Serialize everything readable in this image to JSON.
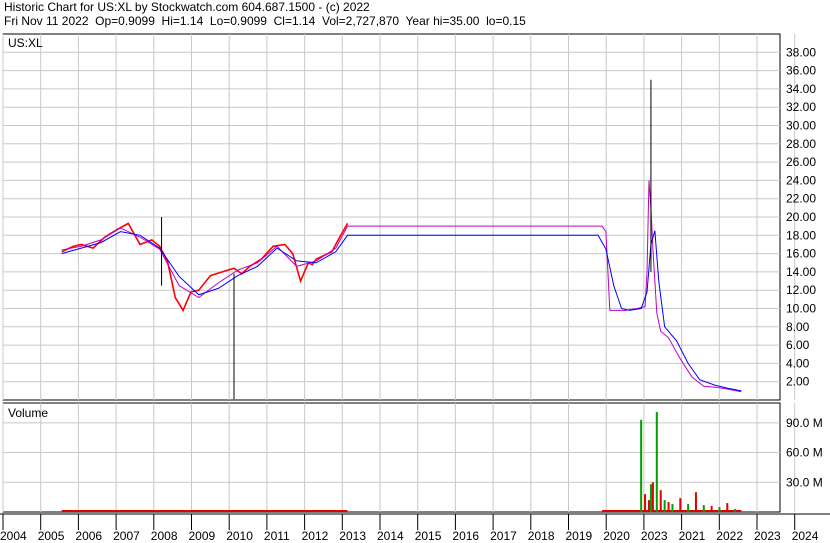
{
  "header": {
    "line1": "Historic Chart for US:XL by Stockwatch.com 604.687.1500 - (c) 2022",
    "line2": "Fri Nov 11 2022  Op=0.9099  Hi=1.14  Lo=0.9099  Cl=1.14  Vol=2,727,870  Year hi=35.00  lo=0.15"
  },
  "colors": {
    "price_up": "#000000",
    "price_down": "#ff0000",
    "ma_short": "#c000c0",
    "ma_long": "#0000ff",
    "vol_up": "#00a000",
    "vol_down": "#e00000",
    "grid": "#c8c8c8"
  },
  "chart_data": [
    {
      "type": "line",
      "panel_label": "US:XL",
      "ylim": [
        0,
        40
      ],
      "yticks": [
        "2.00",
        "4.00",
        "6.00",
        "8.00",
        "10.00",
        "12.00",
        "14.00",
        "16.00",
        "18.00",
        "20.00",
        "22.00",
        "24.00",
        "26.00",
        "28.00",
        "30.00",
        "32.00",
        "34.00",
        "36.00",
        "38.00"
      ],
      "xlim": [
        2004.0,
        2024.0
      ],
      "grid": true,
      "series": [
        {
          "x": [
            2005.5,
            2005.8,
            2006.0,
            2006.3,
            2006.6,
            2006.9,
            2007.2,
            2007.5,
            2007.8,
            2008.0,
            2008.2,
            2008.4,
            2008.6,
            2008.8,
            2009.0,
            2009.3,
            2009.6,
            2009.9,
            2010.1,
            2010.3,
            2010.6,
            2010.9,
            2011.2,
            2011.4,
            2011.6,
            2011.8,
            2011.9,
            2012.0,
            2012.2,
            2012.4,
            2012.6,
            2012.8
          ],
          "values": [
            16.2,
            16.8,
            17.0,
            16.6,
            17.8,
            18.6,
            19.3,
            17.0,
            17.5,
            16.8,
            15.2,
            11.2,
            9.8,
            11.8,
            12.0,
            13.6,
            14.0,
            14.4,
            13.8,
            14.6,
            15.4,
            16.8,
            17.0,
            16.0,
            13.0,
            15.0,
            14.8,
            15.4,
            15.8,
            16.2,
            17.8,
            19.3
          ]
        },
        {
          "x": [
            2005.5,
            2006.0,
            2006.5,
            2007.0,
            2007.5,
            2008.0,
            2008.5,
            2009.0,
            2009.5,
            2010.0,
            2010.5,
            2011.0,
            2011.5,
            2012.0,
            2012.5,
            2012.8,
            2019.3,
            2019.4,
            2019.5,
            2019.9,
            2020.2,
            2020.4,
            2020.45,
            2020.5,
            2020.55,
            2020.6,
            2020.7,
            2020.8,
            2021.0,
            2021.3,
            2021.6,
            2021.9,
            2022.2,
            2022.5,
            2022.86
          ],
          "values": [
            16.4,
            16.8,
            17.5,
            18.8,
            17.8,
            16.5,
            12.5,
            11.2,
            12.8,
            14.2,
            15.0,
            16.8,
            14.6,
            15.2,
            16.6,
            19.0,
            19.0,
            18.4,
            9.8,
            9.8,
            10.0,
            10.2,
            14.0,
            24.0,
            21.0,
            16.5,
            9.5,
            7.5,
            6.8,
            4.5,
            2.5,
            1.5,
            1.4,
            1.2,
            0.9
          ]
        },
        {
          "x": [
            2005.5,
            2006.0,
            2006.5,
            2007.0,
            2007.5,
            2008.0,
            2008.5,
            2009.0,
            2009.5,
            2010.0,
            2010.5,
            2011.0,
            2011.5,
            2012.0,
            2012.5,
            2012.8,
            2019.2,
            2019.4,
            2019.6,
            2019.8,
            2020.0,
            2020.3,
            2020.45,
            2020.55,
            2020.65,
            2020.75,
            2020.9,
            2021.2,
            2021.5,
            2021.8,
            2022.2,
            2022.5,
            2022.86
          ],
          "values": [
            16.0,
            16.6,
            17.2,
            18.4,
            18.0,
            16.6,
            13.5,
            11.5,
            12.2,
            13.6,
            14.6,
            16.6,
            15.2,
            15.0,
            16.2,
            18.0,
            18.0,
            16.5,
            12.5,
            10.0,
            9.8,
            10.0,
            11.8,
            17.0,
            18.5,
            13.0,
            8.0,
            6.5,
            4.0,
            2.2,
            1.6,
            1.3,
            1.0
          ]
        }
      ]
    },
    {
      "type": "bar",
      "panel_label": "Volume",
      "ylim": [
        0,
        110000000
      ],
      "yticks": [
        "30.0 M",
        "60.0 M",
        "90.0 M"
      ],
      "x_ticks": [
        "2004",
        "2005",
        "2006",
        "2007",
        "2008",
        "2009",
        "2010",
        "2011",
        "2012",
        "2013",
        "2014",
        "2015",
        "2016",
        "2017",
        "2018",
        "2019",
        "2020",
        "2023",
        "2021",
        "2022",
        "2023",
        "2024"
      ],
      "bars_x": [
        2020.3,
        2020.4,
        2020.5,
        2020.55,
        2020.6,
        2020.7,
        2020.8,
        2020.9,
        2021.0,
        2021.1,
        2021.3,
        2021.5,
        2021.7,
        2021.9,
        2022.1,
        2022.3,
        2022.5,
        2022.7
      ],
      "bars_value": [
        93000000,
        18000000,
        12000000,
        28000000,
        30000000,
        101000000,
        22000000,
        12000000,
        10000000,
        8000000,
        14000000,
        8000000,
        20000000,
        7000000,
        6000000,
        5000000,
        9000000,
        3000000
      ],
      "bars_color": [
        "up",
        "down",
        "down",
        "up",
        "down",
        "up",
        "down",
        "up",
        "down",
        "up",
        "down",
        "up",
        "down",
        "up",
        "down",
        "up",
        "down",
        "up"
      ],
      "grid": true
    }
  ]
}
